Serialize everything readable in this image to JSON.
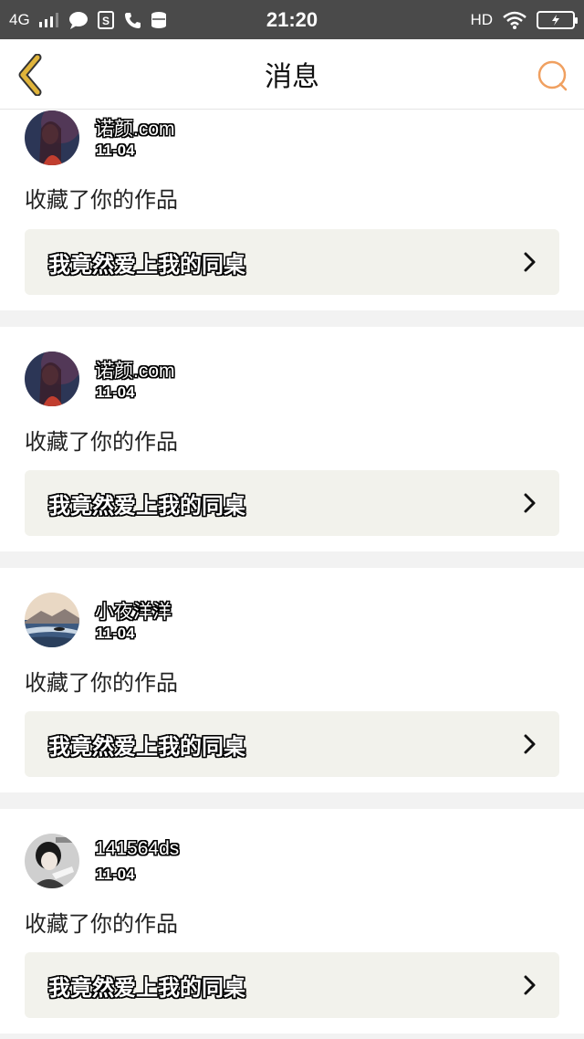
{
  "status_bar": {
    "network": "4G",
    "time": "21:20",
    "hd_label": "HD"
  },
  "nav": {
    "title": "消息"
  },
  "messages": [
    {
      "username": "诺颜.com",
      "date": "11-04",
      "action": "收藏了你的作品",
      "work_title": "我竟然爱上我的同桌"
    },
    {
      "username": "诺颜.com",
      "date": "11-04",
      "action": "收藏了你的作品",
      "work_title": "我竟然爱上我的同桌"
    },
    {
      "username": "小夜洋洋",
      "date": "11-04",
      "action": "收藏了你的作品",
      "work_title": "我竟然爱上我的同桌"
    },
    {
      "username": "141564ds",
      "date": "11-04",
      "action": "收藏了你的作品",
      "work_title": "我竟然爱上我的同桌"
    }
  ],
  "colors": {
    "status_bar_bg": "#4a4a4a",
    "back_arrow": "#e0b43a",
    "search_icon": "#f0a060",
    "link_bg": "#f2f2ec"
  }
}
